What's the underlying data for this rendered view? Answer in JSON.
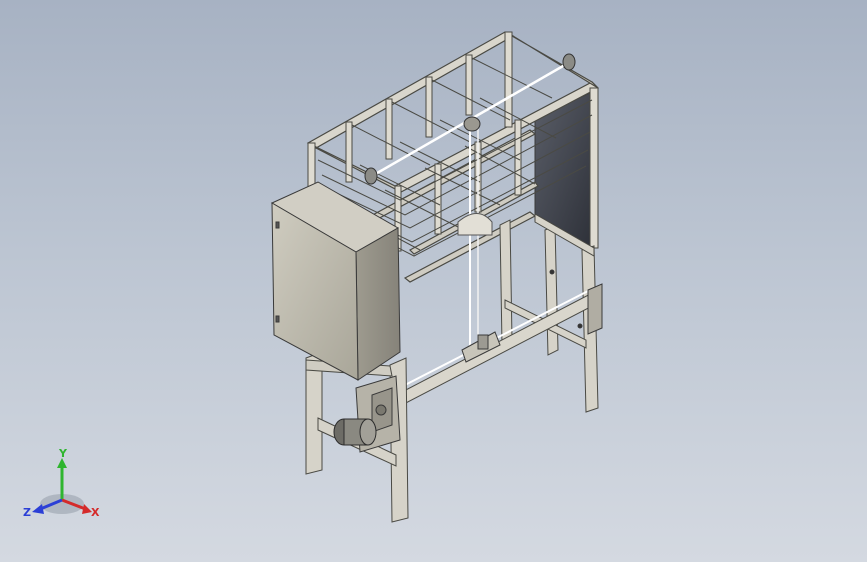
{
  "viewport": {
    "background_top": "#a7b2c3",
    "background_bottom": "#d4d9e1"
  },
  "model": {
    "frame_color": "#d9d6cc",
    "panel_color": "#bcb9ad",
    "back_panel_color": "#3b3f48",
    "rope_color": "#ffffff"
  },
  "triad": {
    "x_label": "X",
    "y_label": "Y",
    "z_label": "Z",
    "x_color": "#d42a2a",
    "y_color": "#2fb52f",
    "z_color": "#2b3fd6"
  }
}
